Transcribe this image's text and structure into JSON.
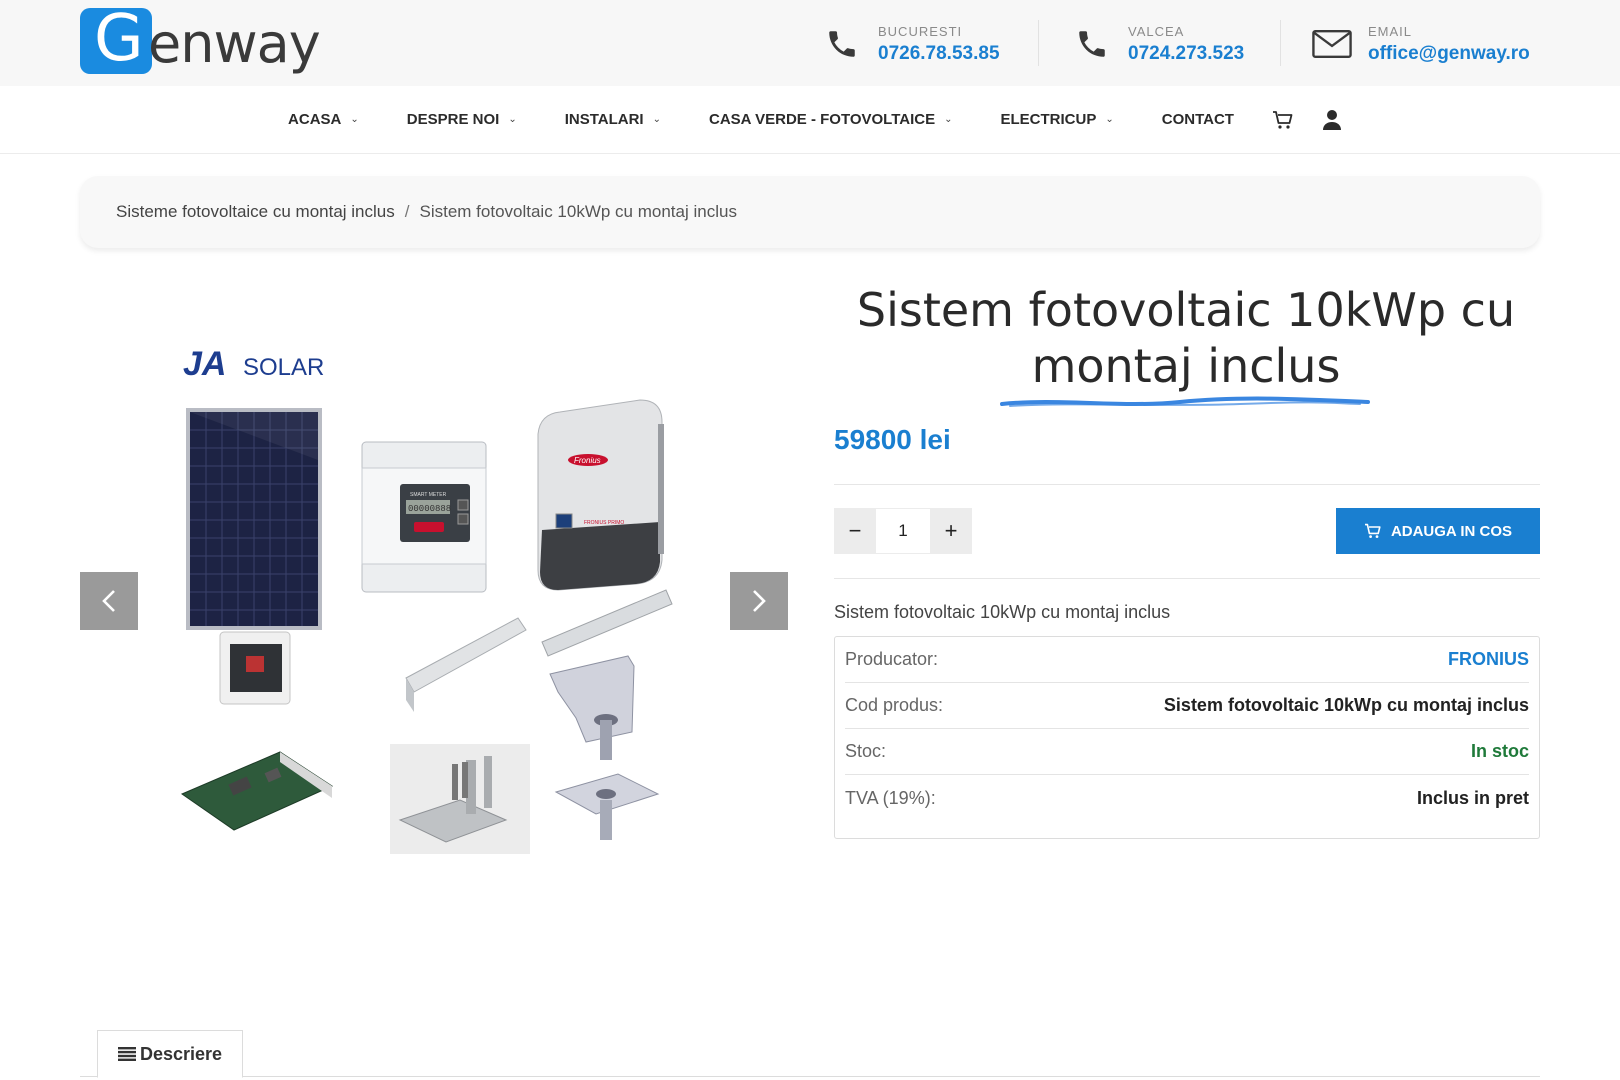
{
  "brand": {
    "logo_letter": "G",
    "logo_rest": "enway"
  },
  "contacts": [
    {
      "label": "BUCURESTI",
      "value": "0726.78.53.85",
      "icon": "phone-icon"
    },
    {
      "label": "VALCEA",
      "value": "0724.273.523",
      "icon": "phone-icon"
    },
    {
      "label": "EMAIL",
      "value": "office@genway.ro",
      "icon": "envelope-icon"
    }
  ],
  "nav": {
    "items": [
      {
        "label": "ACASA",
        "dropdown": true
      },
      {
        "label": "DESPRE NOI",
        "dropdown": true
      },
      {
        "label": "INSTALARI",
        "dropdown": true
      },
      {
        "label": "CASA VERDE - FOTOVOLTAICE",
        "dropdown": true
      },
      {
        "label": "ELECTRICUP",
        "dropdown": true
      },
      {
        "label": "CONTACT",
        "dropdown": false
      }
    ],
    "icons": [
      "cart-icon",
      "user-icon"
    ]
  },
  "breadcrumb": {
    "parent": "Sisteme fotovoltaice cu montaj inclus",
    "separator": "/",
    "current": "Sistem fotovoltaic 10kWp cu montaj inclus"
  },
  "gallery": {
    "brand_label_ja": "JA",
    "brand_label_solar": "SOLAR",
    "meter_label": "SMART METER",
    "meter_reading": "00000888",
    "inverter_brand": "Fronius",
    "inverter_model": "FRONIUS PRIMO"
  },
  "product": {
    "title_line1": "Sistem fotovoltaic 10kWp cu",
    "title_line2": "montaj inclus",
    "price": "59800 lei",
    "quantity": "1",
    "minus": "−",
    "plus": "+",
    "add_to_cart": "ADAUGA IN COS",
    "short_description": "Sistem fotovoltaic 10kWp cu montaj inclus",
    "specs": [
      {
        "key": "Producator:",
        "value": "FRONIUS",
        "style": "blue"
      },
      {
        "key": "Cod produs:",
        "value": "Sistem fotovoltaic 10kWp cu montaj inclus",
        "style": ""
      },
      {
        "key": "Stoc:",
        "value": "In stoc",
        "style": "green"
      },
      {
        "key": "TVA (19%):",
        "value": "Inclus in pret",
        "style": ""
      }
    ]
  },
  "tabs": [
    {
      "label": "Descriere",
      "icon": "list-icon"
    }
  ],
  "colors": {
    "accent": "#1a7fd0",
    "stock": "#1f7a3a",
    "topbar": "#f7f7f7"
  }
}
